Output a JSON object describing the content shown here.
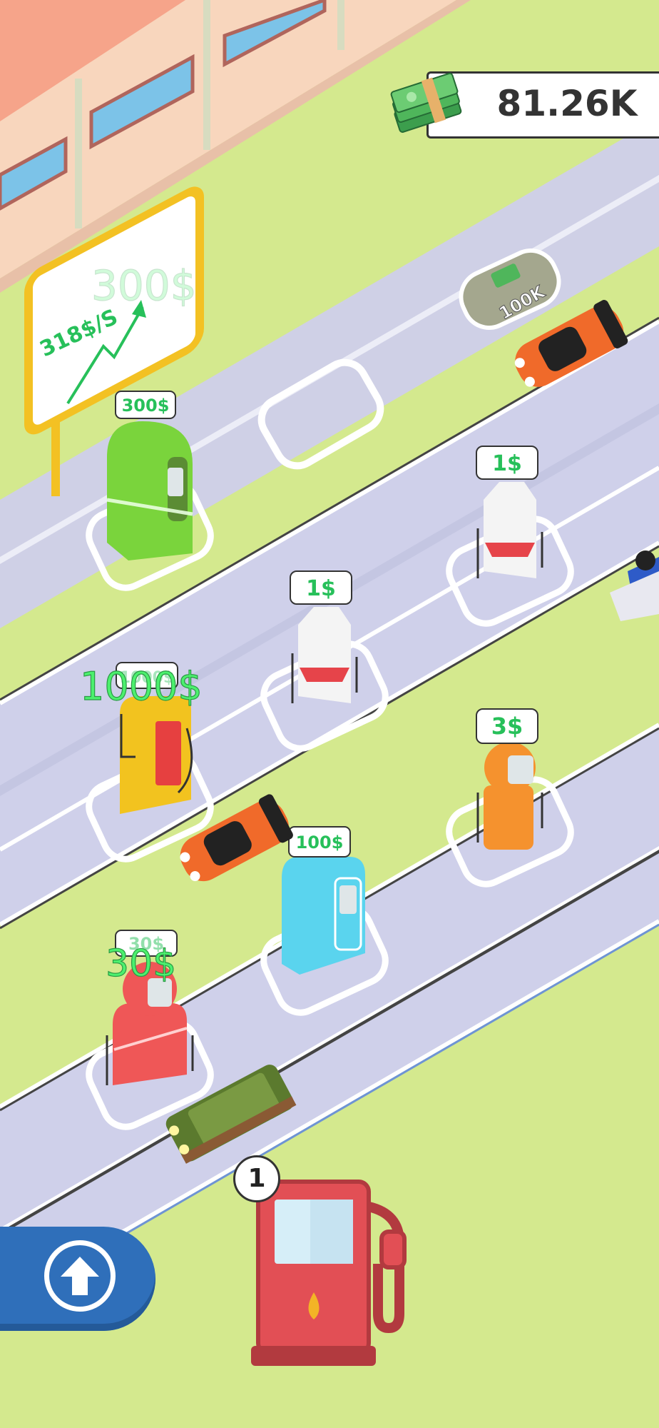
{
  "hud": {
    "balance": "81.26K",
    "money_icon": "cash-stack-icon"
  },
  "billboard": {
    "rate": "318$/S",
    "float_text": "300$"
  },
  "bonus_pad": {
    "label": "100K",
    "icon": "cash-stack-icon"
  },
  "pumps": [
    {
      "price": "300$",
      "color": "#7ad43c"
    },
    {
      "price": "1$",
      "color": "#f4f4f4"
    },
    {
      "price": "1$",
      "color": "#f4f4f4"
    },
    {
      "price": "1000$",
      "color": "#f2c31f"
    },
    {
      "price": "3$",
      "color": "#f5922e"
    },
    {
      "price": "100$",
      "color": "#5ad4ee"
    },
    {
      "price": "30$",
      "color": "#ef5757"
    }
  ],
  "float_texts": {
    "yellow_pump": "1000$",
    "red_pump": "30$"
  },
  "build_button": {
    "count": "1",
    "icon": "fuel-pump-icon"
  },
  "upgrade_button": {
    "icon": "arrow-up-icon"
  },
  "colors": {
    "grass": "#d4e98e",
    "road": "#cfd0ea",
    "accent_green": "#27c05a",
    "upgrade_blue": "#2f6fba"
  }
}
